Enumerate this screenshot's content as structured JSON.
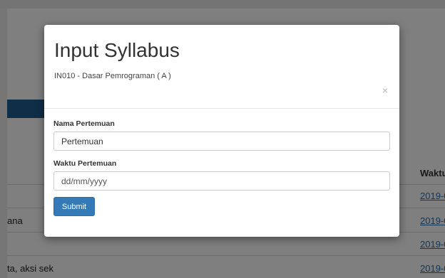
{
  "background": {
    "column_header": "Waktu",
    "rows": [
      {
        "name": "",
        "date": "2019-0"
      },
      {
        "name": "ana",
        "date": "2019-0"
      },
      {
        "name": "",
        "date": "2019-0"
      },
      {
        "name": "ta, aksi sek",
        "date": "2019-0"
      }
    ]
  },
  "modal": {
    "title": "Input Syllabus",
    "subtitle": "IN010 - Dasar Pemrograman ( A )",
    "close_symbol": "×",
    "fields": [
      {
        "label": "Nama Pertemuan",
        "value": "Pertemuan",
        "placeholder": ""
      },
      {
        "label": "Waktu Pertemuan",
        "value": "",
        "placeholder": "dd/mm/yyyy"
      }
    ],
    "submit_label": "Submit"
  },
  "colors": {
    "primary": "#337ab7",
    "backdrop": "rgba(0,0,0,0.5)",
    "sidebar_active": "#1f5d8e"
  }
}
